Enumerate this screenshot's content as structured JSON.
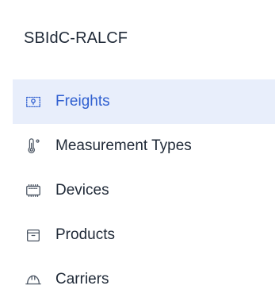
{
  "sidebar": {
    "title": "SBIdC-RALCF",
    "accent_color": "#2f5fd0",
    "active_bg": "#e8eefb",
    "items": [
      {
        "label": "Freights",
        "icon": "map-route-icon",
        "active": true
      },
      {
        "label": "Measurement Types",
        "icon": "thermometer-icon",
        "active": false
      },
      {
        "label": "Devices",
        "icon": "device-chip-icon",
        "active": false
      },
      {
        "label": "Products",
        "icon": "box-icon",
        "active": false
      },
      {
        "label": "Carriers",
        "icon": "hard-hat-icon",
        "active": false
      }
    ]
  }
}
